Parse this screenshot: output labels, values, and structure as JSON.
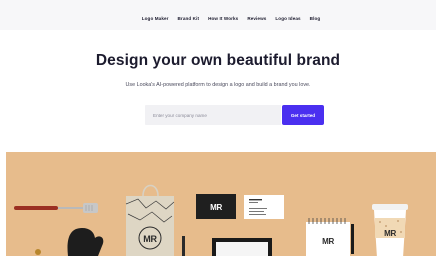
{
  "nav": {
    "items": [
      {
        "label": "Logo Maker"
      },
      {
        "label": "Brand Kit"
      },
      {
        "label": "How It Works"
      },
      {
        "label": "Reviews"
      },
      {
        "label": "Logo Ideas"
      },
      {
        "label": "Blog"
      }
    ]
  },
  "hero": {
    "headline": "Design your own beautiful brand",
    "subheadline": "Use Looka's AI-powered platform to design a logo and build a brand you love.",
    "input_placeholder": "Enter your company name",
    "cta_label": "Get started"
  },
  "photo": {
    "monogram": "MR",
    "colors": {
      "background": "#e7bc8c",
      "cta": "#4a2ff0",
      "ink": "#1c1b2e"
    }
  }
}
